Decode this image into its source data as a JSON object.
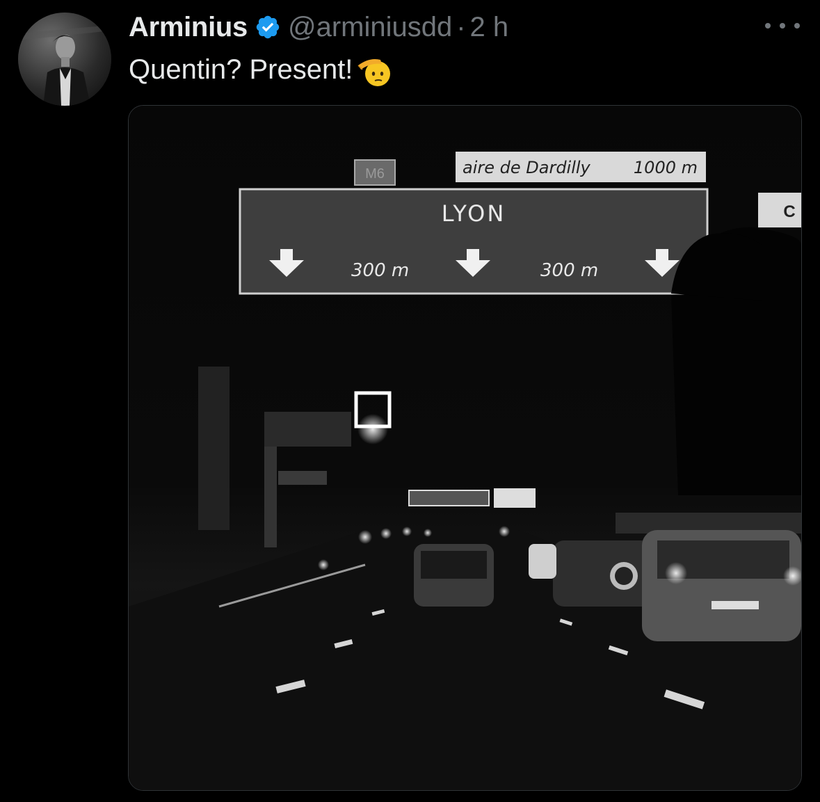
{
  "tweet": {
    "author_name": "Arminius",
    "handle": "@arminiusdd",
    "separator": "·",
    "time": "2 h",
    "text": "Quentin? Present!",
    "emoji": "saluting-face-emoji",
    "verified_color": "#1d9bf0",
    "more_icon": "more-options-icon"
  },
  "photo": {
    "road_number": "M6",
    "rest_area_name": "aire de Dardilly",
    "rest_area_distance": "1000 m",
    "main_destination": "LYON",
    "distance_left": "300 m",
    "distance_right": "300 m",
    "partial_sign_letter": "C"
  }
}
